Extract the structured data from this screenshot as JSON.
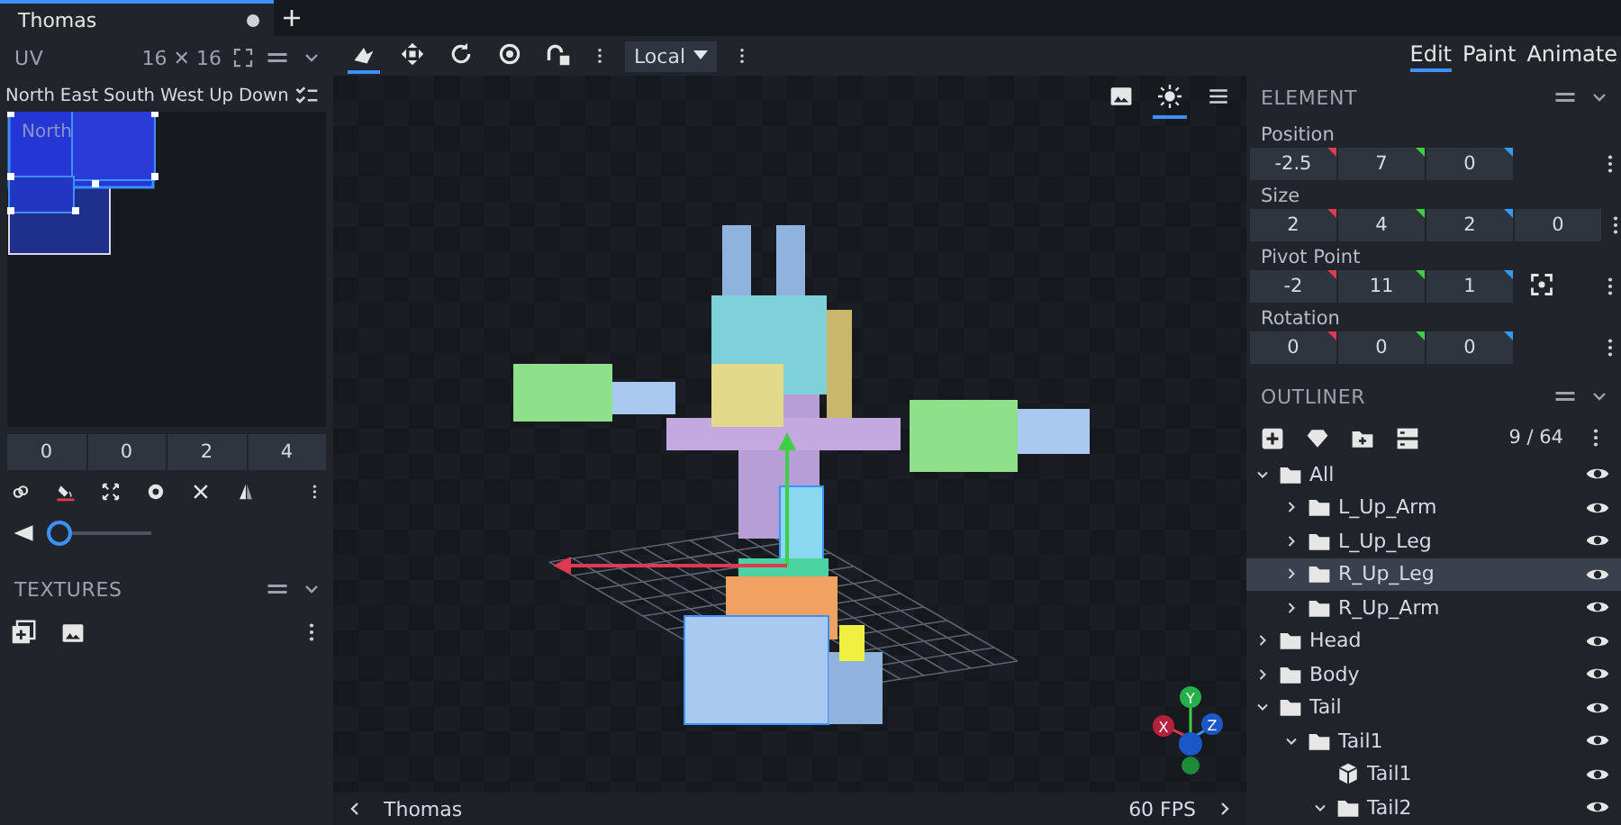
{
  "tabs": [
    {
      "label": "Thomas",
      "selected": true,
      "unsaved": true
    }
  ],
  "uv_panel": {
    "title": "UV",
    "size": "16 ✕ 16",
    "faces": [
      "North",
      "East",
      "South",
      "West",
      "Up",
      "Down"
    ],
    "face_label": "North",
    "inputs": [
      "0",
      "0",
      "2",
      "4"
    ],
    "slider": {
      "level": 0.0
    }
  },
  "textures_panel": {
    "title": "TEXTURES"
  },
  "toolbar": {
    "tools": [
      {
        "kind": "move-cursor",
        "selected": true
      },
      {
        "kind": "move",
        "selected": false
      },
      {
        "kind": "rotate",
        "selected": false
      },
      {
        "kind": "pivot",
        "selected": false
      },
      {
        "kind": "vertex",
        "selected": false
      }
    ],
    "space": "Local"
  },
  "view_buttons": [
    {
      "kind": "image",
      "selected": false
    },
    {
      "kind": "sun",
      "selected": true
    },
    {
      "kind": "menu",
      "selected": false
    }
  ],
  "modes": [
    {
      "label": "Edit",
      "selected": true
    },
    {
      "label": "Paint",
      "selected": false
    },
    {
      "label": "Animate",
      "selected": false
    }
  ],
  "element_panel": {
    "title": "ELEMENT",
    "fields": [
      {
        "label": "Position",
        "values": [
          "-2.5",
          "7",
          "0"
        ],
        "kind": "vector"
      },
      {
        "label": "Size",
        "values": [
          "2",
          "4",
          "2",
          "0"
        ],
        "kind": "size"
      },
      {
        "label": "Pivot Point",
        "values": [
          "-2",
          "11",
          "1"
        ],
        "kind": "pivot"
      },
      {
        "label": "Rotation",
        "values": [
          "0",
          "0",
          "0"
        ],
        "kind": "vector"
      }
    ]
  },
  "outliner": {
    "title": "OUTLINER",
    "count": "9 / 64",
    "tree": [
      {
        "name": "All",
        "kind": "group",
        "expanded": true,
        "selected": false,
        "children": [
          {
            "name": "L_Up_Arm",
            "kind": "group",
            "expanded": false,
            "selected": false
          },
          {
            "name": "L_Up_Leg",
            "kind": "group",
            "expanded": false,
            "selected": false
          },
          {
            "name": "R_Up_Leg",
            "kind": "group",
            "expanded": false,
            "selected": true
          },
          {
            "name": "R_Up_Arm",
            "kind": "group",
            "expanded": false,
            "selected": false
          }
        ]
      },
      {
        "name": "Head",
        "kind": "group",
        "expanded": false,
        "selected": false
      },
      {
        "name": "Body",
        "kind": "group",
        "expanded": false,
        "selected": false
      },
      {
        "name": "Tail",
        "kind": "group",
        "expanded": true,
        "selected": false,
        "children": [
          {
            "name": "Tail1",
            "kind": "group",
            "expanded": true,
            "selected": false,
            "children": [
              {
                "name": "Tail1",
                "kind": "cube",
                "selected": false
              },
              {
                "name": "Tail2",
                "kind": "group",
                "expanded": true,
                "selected": false
              }
            ]
          }
        ]
      }
    ]
  },
  "gizmo": {
    "labels": [
      "X",
      "Y",
      "Z"
    ]
  },
  "status_bar": {
    "model": "Thomas",
    "fps": "60 FPS"
  }
}
